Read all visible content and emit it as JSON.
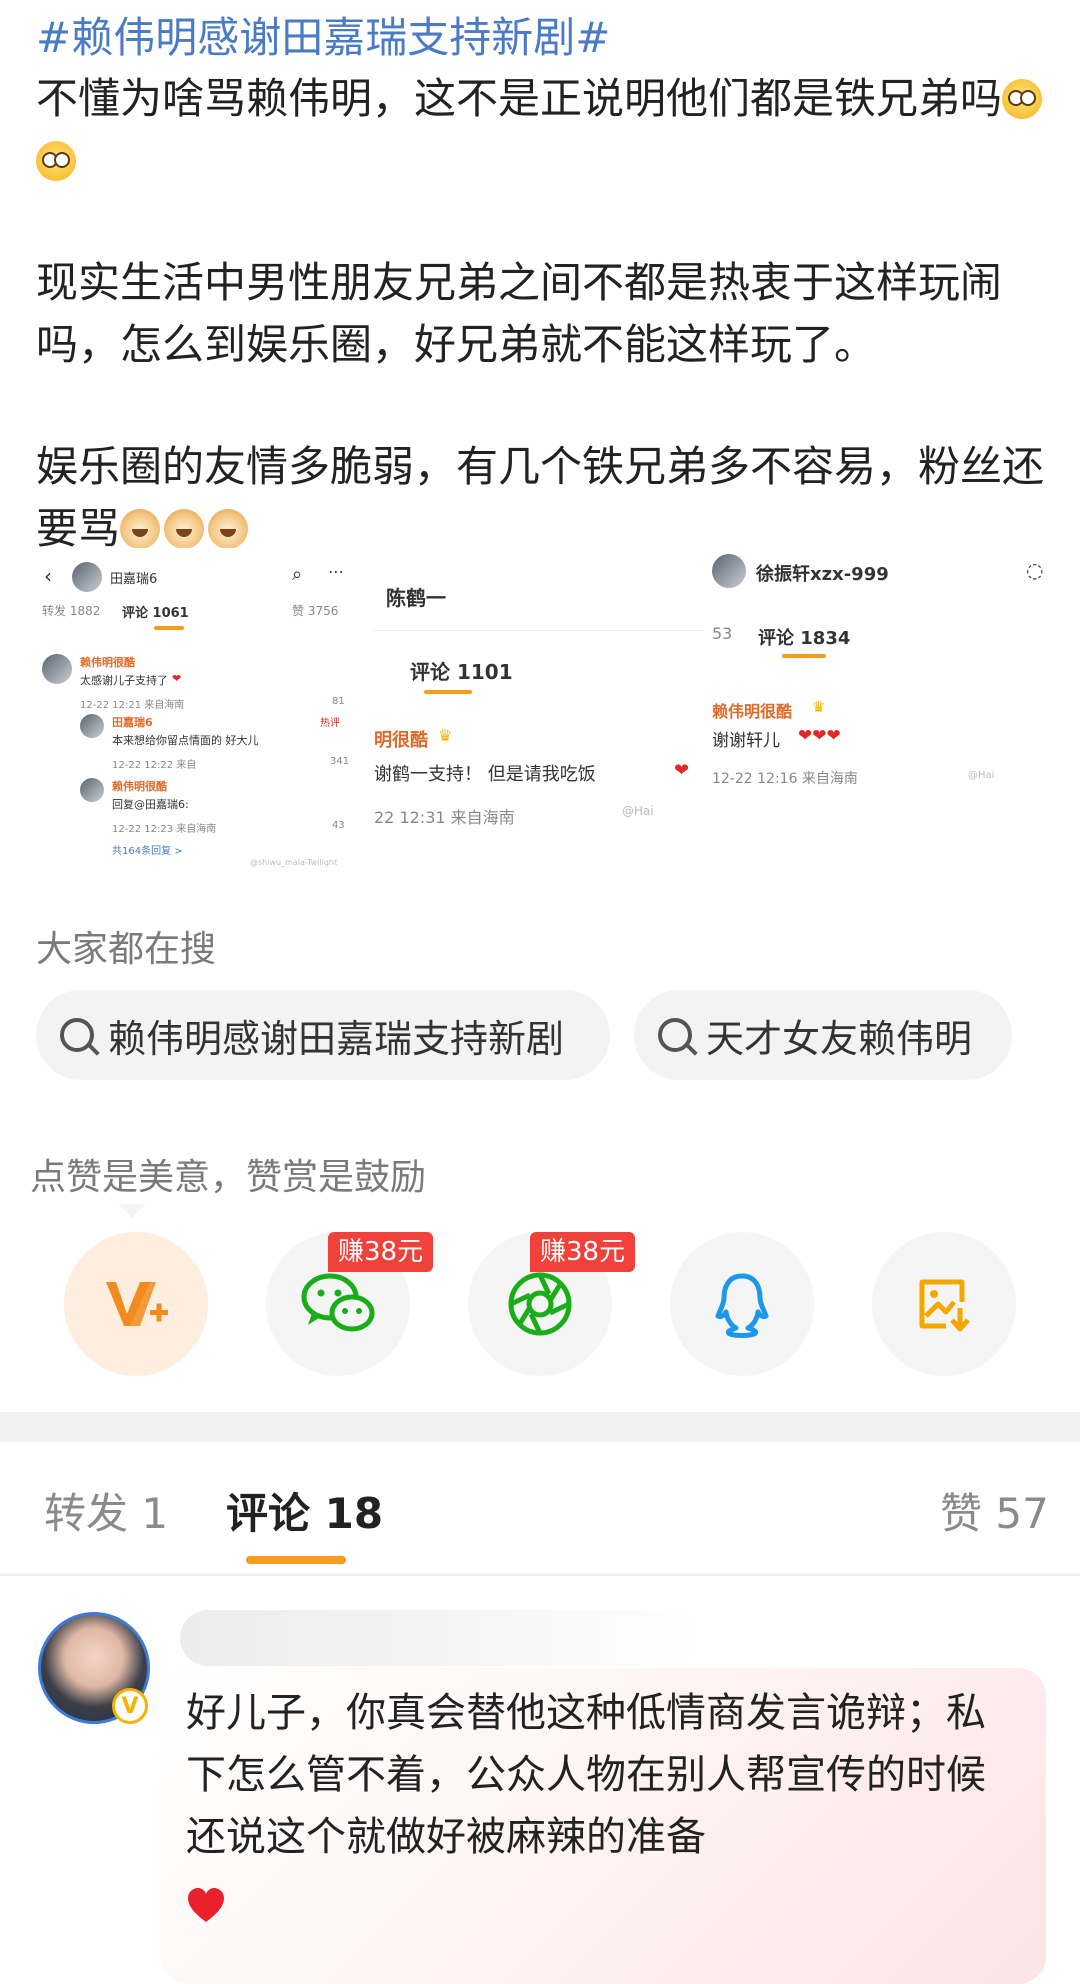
{
  "post": {
    "topic": "#赖伟明感谢田嘉瑞支持新剧#",
    "para1": "不懂为啥骂赖伟明，这不是正说明他们都是铁兄弟吗",
    "para2": "现实生活中男性朋友兄弟之间不都是热衷于这样玩闹吗，怎么到娱乐圈，好兄弟就不能这样玩了。",
    "para3": "娱乐圈的友情多脆弱，有几个铁兄弟多不容易，粉丝还要骂",
    "emoji1": "flushed-emoji",
    "emoji3": "doge-emoji"
  },
  "shot1": {
    "user": "田嘉瑞6",
    "tab_repost": "转发 1882",
    "tab_comments": "评论 1061",
    "tab_likes": "赞 3756",
    "c1_name": "赖伟明很酷",
    "c1_text": "太感谢儿子支持了",
    "c1_meta": "12-22 12:21 来自海南",
    "c1_likes": "81",
    "c2_name": "田嘉瑞6",
    "c2_text": "本来想给你留点情面的 好大儿",
    "c2_meta": "12-22 12:22 来自",
    "c2_likes": "341",
    "c2_tag": "热评",
    "c3_name": "赖伟明很酷",
    "c3_text": "回复@田嘉瑞6:",
    "c3_meta": "12-22 12:23 来自海南",
    "c3_likes": "43",
    "more": "共164条回复 >",
    "watermark": "@shiwu_mala-Twilight"
  },
  "shot2": {
    "user": "陈鹤一",
    "tab_comments": "评论 1101",
    "c_name": "明很酷",
    "c_text": "谢鹤一支持！ 但是请我吃饭",
    "c_meta": "22 12:31 来自海南",
    "watermark": "@Hai"
  },
  "shot3": {
    "user": "徐振轩xzx-999",
    "tab_prefix": "53",
    "tab_comments": "评论 1834",
    "c_name": "赖伟明很酷",
    "c_text": "谢谢轩儿",
    "c_meta": "12-22 12:16 来自海南",
    "watermark": "@Hai"
  },
  "hot_search": {
    "title": "大家都在搜",
    "items": [
      "赖伟明感谢田嘉瑞支持新剧",
      "天才女友赖伟明"
    ]
  },
  "reward": {
    "tip": "点赞是美意，赞赏是鼓励",
    "earn1": "赚38元",
    "earn2": "赚38元"
  },
  "share_icons": [
    "vip-reward-icon",
    "wechat-icon",
    "moments-icon",
    "qq-icon",
    "save-image-icon"
  ],
  "tabs": {
    "repost": "转发 1",
    "comments": "评论 18",
    "likes": "赞 57"
  },
  "comment": {
    "text": "好儿子，你真会替他这种低情商发言诡辩；私下怎么管不着，公众人物在别人帮宣传的时候还说这个就做好被麻辣的准备"
  },
  "colors": {
    "topic": "#4a7bc4",
    "accent": "#f79b1f",
    "earn_badge": "#f0413a"
  }
}
